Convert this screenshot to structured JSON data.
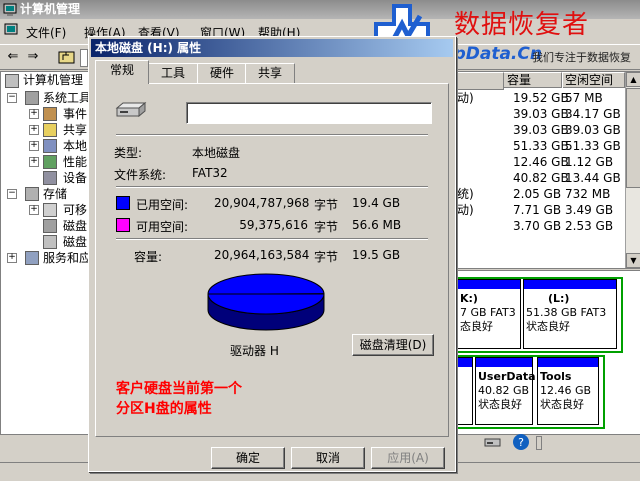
{
  "app": {
    "title": "计算机管理"
  },
  "menu": [
    {
      "label": "文件(F)"
    },
    {
      "label": "操作(A)"
    },
    {
      "label": "查看(V)"
    },
    {
      "label": "窗口(W)"
    },
    {
      "label": "帮助(H)"
    }
  ],
  "tree": [
    {
      "label": "计算机管理"
    },
    {
      "label": "系统工具"
    },
    {
      "label": "事件"
    },
    {
      "label": "共享"
    },
    {
      "label": "本地"
    },
    {
      "label": "性能"
    },
    {
      "label": "设备"
    },
    {
      "label": "存储"
    },
    {
      "label": "可移"
    },
    {
      "label": "磁盘"
    },
    {
      "label": "磁盘"
    },
    {
      "label": "服务和应"
    }
  ],
  "volume_list": {
    "columns": [
      "容量",
      "空闲空间"
    ],
    "rows": [
      {
        "status": "动)",
        "capacity": "19.52 GB",
        "free": "57 MB"
      },
      {
        "status": "",
        "capacity": "39.03 GB",
        "free": "34.17 GB"
      },
      {
        "status": "",
        "capacity": "39.03 GB",
        "free": "39.03 GB"
      },
      {
        "status": "",
        "capacity": "51.33 GB",
        "free": "51.33 GB"
      },
      {
        "status": "",
        "capacity": "12.46 GB",
        "free": "1.12 GB"
      },
      {
        "status": "",
        "capacity": "40.82 GB",
        "free": "13.44 GB"
      },
      {
        "status": "统)",
        "capacity": "2.05 GB",
        "free": "732 MB"
      },
      {
        "status": "动)",
        "capacity": "7.71 GB",
        "free": "3.49 GB"
      },
      {
        "status": "",
        "capacity": "3.70 GB",
        "free": "2.53 GB"
      }
    ]
  },
  "disk_graph": {
    "top_volumes": [
      {
        "name": "K:)",
        "line1": "7 GB FAT3",
        "line2": "态良好"
      },
      {
        "name": "(L:)",
        "line1": "51.38 GB FAT3",
        "line2": "状态良好"
      }
    ],
    "bottom_volumes": [
      {
        "name": "",
        "line1": "",
        "line2": ""
      },
      {
        "name": "UserData",
        "line1": "40.82 GB",
        "line2": "状态良好"
      },
      {
        "name": "Tools",
        "line1": "12.46 GB",
        "line2": "状态良好"
      }
    ]
  },
  "watermark": {
    "brand": "数据恢复者",
    "site": "HelpData.Cn",
    "slogan": "我们专注于数据恢复"
  },
  "dialog": {
    "title": "本地磁盘 (H:) 属性",
    "tabs": [
      {
        "label": "常规",
        "active": true
      },
      {
        "label": "工具",
        "active": false
      },
      {
        "label": "硬件",
        "active": false
      },
      {
        "label": "共享",
        "active": false
      }
    ],
    "volume_name": "",
    "type_label": "类型:",
    "type_value": "本地磁盘",
    "fs_label": "文件系统:",
    "fs_value": "FAT32",
    "used": {
      "label": "已用空间:",
      "bytes": "20,904,787,968",
      "unit": "字节",
      "size": "19.4 GB",
      "color": "#0000ff"
    },
    "free": {
      "label": "可用空间:",
      "bytes": "59,375,616",
      "unit": "字节",
      "size": "56.6 MB",
      "color": "#ff00ff"
    },
    "capacity": {
      "label": "容量:",
      "bytes": "20,964,163,584",
      "unit": "字节",
      "size": "19.5 GB"
    },
    "drive_label": "驱动器 H",
    "cleanup_button": "磁盘清理(D)",
    "annotation": [
      "客户硬盘当前第一个",
      "分区H盘的属性"
    ],
    "annotation_color": "#ff0000",
    "buttons": {
      "ok": "确定",
      "cancel": "取消",
      "apply": "应用(A)"
    }
  }
}
